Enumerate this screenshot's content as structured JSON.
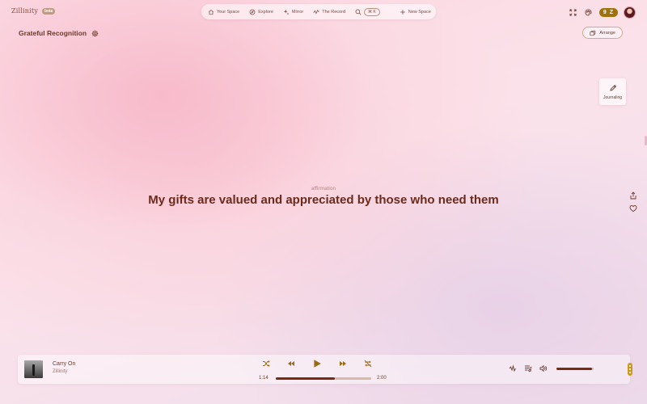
{
  "brand": {
    "name": "Zillinity",
    "badge": "beta"
  },
  "nav": {
    "items": [
      {
        "label": "Your Space",
        "icon": "home-icon"
      },
      {
        "label": "Explore",
        "icon": "compass-icon"
      },
      {
        "label": "Mirror",
        "icon": "sparkle-icon"
      },
      {
        "label": "The Record",
        "icon": "wave-icon"
      }
    ],
    "search_shortcut": "⌘ K",
    "new_space": "New Space"
  },
  "user": {
    "score": "9 Z"
  },
  "space": {
    "title": "Grateful Recognition",
    "arrange_label": "Arrange"
  },
  "journal": {
    "label": "Journaling"
  },
  "affirmation": {
    "label": "affirmation",
    "text": "My gifts are valued and appreciated by those who need them"
  },
  "player": {
    "track_title": "Carry On",
    "artist": "Zillinity",
    "elapsed": "1:14",
    "duration": "2:00",
    "progress": 0.62,
    "volume": 0.95
  },
  "colors": {
    "accent": "#a0720c",
    "text": "#6b2a1a",
    "progress": "#7a2a12"
  }
}
